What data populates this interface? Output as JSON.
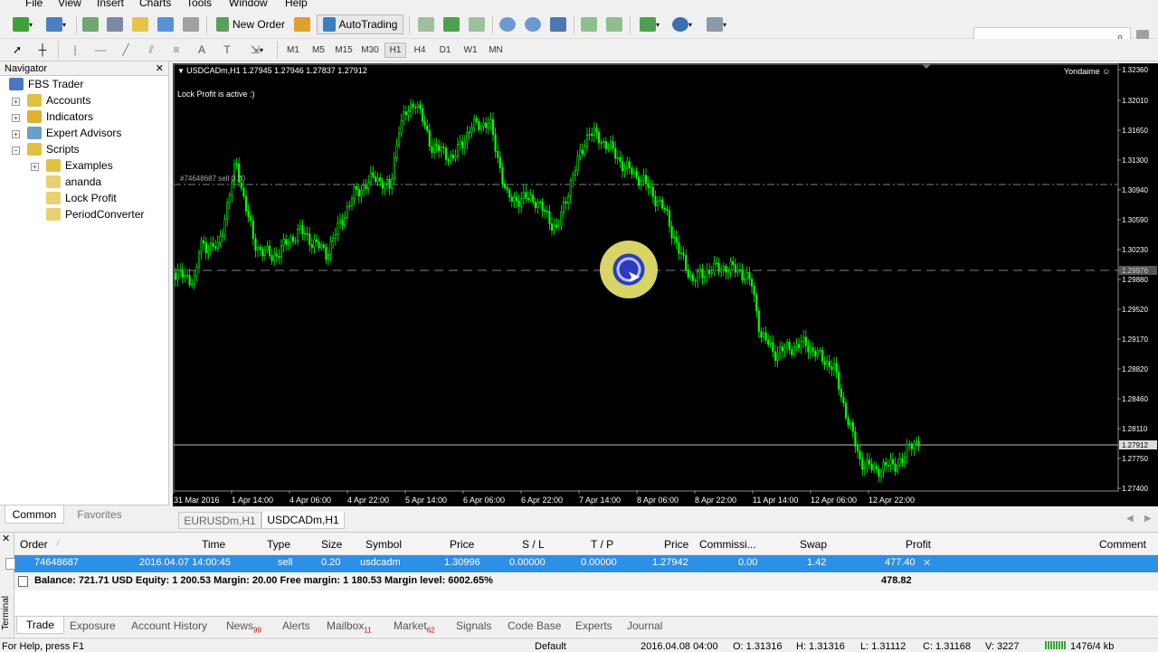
{
  "menu": [
    "File",
    "View",
    "Insert",
    "Charts",
    "Tools",
    "Window",
    "Help"
  ],
  "toolbar": {
    "new_order": "New Order",
    "auto_trading": "AutoTrading"
  },
  "timeframes": [
    "M1",
    "M5",
    "M15",
    "M30",
    "H1",
    "H4",
    "D1",
    "W1",
    "MN"
  ],
  "active_timeframe": "H1",
  "navigator": {
    "title": "Navigator",
    "items": [
      {
        "label": "FBS Trader",
        "icon": "terminal-icon"
      },
      {
        "label": "Accounts",
        "icon": "accounts-icon"
      },
      {
        "label": "Indicators",
        "icon": "indicators-icon"
      },
      {
        "label": "Expert Advisors",
        "icon": "expert-advisors-icon"
      },
      {
        "label": "Scripts",
        "icon": "scripts-icon"
      },
      {
        "label": "Examples",
        "icon": "folder-icon"
      },
      {
        "label": "ananda",
        "icon": "script-icon"
      },
      {
        "label": "Lock Profit",
        "icon": "script-icon"
      },
      {
        "label": "PeriodConverter",
        "icon": "script-icon"
      }
    ],
    "tabs": [
      "Common",
      "Favorites"
    ]
  },
  "chart": {
    "header": "USDCADm,H1  1.27945 1.27946 1.27837 1.27912",
    "comment": "Lock Profit is active :)",
    "order_label": "#74648687 sell 0.20",
    "expert_name": "Yondaime",
    "price_labels": [
      "1.32360",
      "1.32010",
      "1.31650",
      "1.31300",
      "1.30940",
      "1.30590",
      "1.30230",
      "1.29976",
      "1.29880",
      "1.29520",
      "1.29170",
      "1.28820",
      "1.28460",
      "1.28110",
      "1.27912",
      "1.27750",
      "1.27400"
    ],
    "time_labels": [
      "31 Mar 2016",
      "1 Apr 14:00",
      "4 Apr 06:00",
      "4 Apr 22:00",
      "5 Apr 14:00",
      "6 Apr 06:00",
      "6 Apr 22:00",
      "7 Apr 14:00",
      "8 Apr 06:00",
      "8 Apr 22:00",
      "11 Apr 14:00",
      "12 Apr 06:00",
      "12 Apr 22:00"
    ],
    "colors": {
      "background": "#000000",
      "candles": "#00ff00",
      "order_line": "#808080",
      "current_price": "#c0c0c0"
    }
  },
  "chart_tabs": [
    "EURUSDm,H1",
    "USDCADm,H1"
  ],
  "terminal": {
    "side_label": "Terminal",
    "headers": [
      "Order",
      "Time",
      "Type",
      "Size",
      "Symbol",
      "Price",
      "S / L",
      "T / P",
      "Price",
      "Commissi...",
      "Swap",
      "Profit",
      "Comment"
    ],
    "row": [
      "74648687",
      "2016.04.07 14:00:45",
      "sell",
      "0.20",
      "usdcadm",
      "1.30996",
      "0.00000",
      "0.00000",
      "1.27942",
      "0.00",
      "1.42",
      "477.40"
    ],
    "balance": "Balance: 721.71 USD  Equity: 1 200.53  Margin: 20.00  Free margin: 1 180.53  Margin level: 6002.65%",
    "total_profit": "478.82",
    "tabs": [
      {
        "label": "Trade",
        "badge": ""
      },
      {
        "label": "Exposure",
        "badge": ""
      },
      {
        "label": "Account History",
        "badge": ""
      },
      {
        "label": "News",
        "badge": "99"
      },
      {
        "label": "Alerts",
        "badge": ""
      },
      {
        "label": "Mailbox",
        "badge": "11"
      },
      {
        "label": "Market",
        "badge": "62"
      },
      {
        "label": "Signals",
        "badge": ""
      },
      {
        "label": "Code Base",
        "badge": ""
      },
      {
        "label": "Experts",
        "badge": ""
      },
      {
        "label": "Journal",
        "badge": ""
      }
    ]
  },
  "status": {
    "help": "For Help, press F1",
    "profile": "Default",
    "time": "2016.04.08 04:00",
    "open": "O: 1.31316",
    "high": "H: 1.31316",
    "low": "L: 1.31112",
    "close": "C: 1.31168",
    "volume": "V: 3227",
    "traffic": "1476/4 kb"
  }
}
